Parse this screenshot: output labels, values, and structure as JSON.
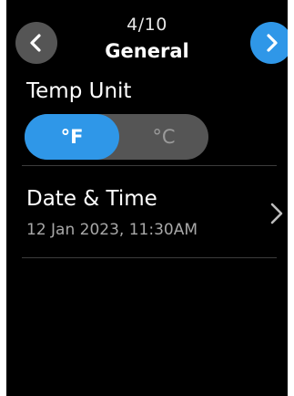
{
  "header": {
    "page_counter": "4/10",
    "title": "General",
    "prev_icon": "chevron-left-icon",
    "next_icon": "chevron-right-icon"
  },
  "temp_unit": {
    "label": "Temp Unit",
    "options": [
      "°F",
      "°C"
    ],
    "selected": "°F"
  },
  "date_time": {
    "title": "Date & Time",
    "value": "12 Jan 2023, 11:30AM",
    "icon": "chevron-right-icon"
  },
  "colors": {
    "background": "#000000",
    "accent": "#2f97e8",
    "control_gray": "#555555",
    "secondary_text": "#a8a8a8"
  }
}
